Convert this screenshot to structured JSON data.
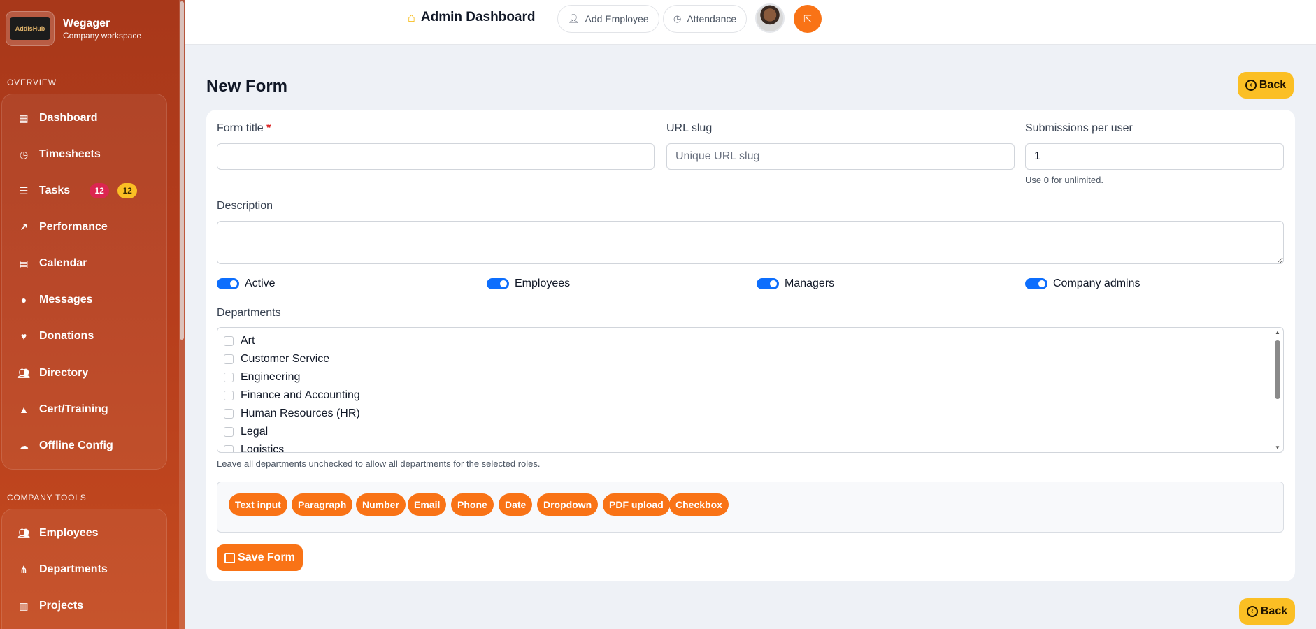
{
  "brand": {
    "logo_text": "AddisHub",
    "name": "Wegager",
    "subtitle": "Company workspace"
  },
  "sidebar": {
    "overview_label": "OVERVIEW",
    "items": [
      {
        "label": "Dashboard",
        "icon": "dashboard-icon"
      },
      {
        "label": "Timesheets",
        "icon": "clock-icon"
      },
      {
        "label": "Tasks",
        "icon": "list-icon",
        "badge_red": "12",
        "badge_yellow": "12"
      },
      {
        "label": "Performance",
        "icon": "chart-line-icon"
      },
      {
        "label": "Calendar",
        "icon": "calendar-icon"
      },
      {
        "label": "Messages",
        "icon": "chat-icon"
      },
      {
        "label": "Donations",
        "icon": "heart-icon"
      },
      {
        "label": "Directory",
        "icon": "people-icon"
      },
      {
        "label": "Cert/Training",
        "icon": "graduation-cap-icon"
      },
      {
        "label": "Offline Config",
        "icon": "cloud-upload-icon"
      }
    ],
    "tools_label": "COMPANY TOOLS",
    "tools": [
      {
        "label": "Employees",
        "icon": "people-icon"
      },
      {
        "label": "Departments",
        "icon": "sitemap-icon"
      },
      {
        "label": "Projects",
        "icon": "kanban-icon"
      }
    ]
  },
  "topbar": {
    "title": "Admin Dashboard",
    "add_employee": "Add Employee",
    "attendance": "Attendance"
  },
  "page": {
    "title": "New Form",
    "back_label": "Back"
  },
  "form": {
    "title_label": "Form title",
    "required_mark": "*",
    "title_value": "",
    "slug_label": "URL slug",
    "slug_placeholder": "Unique URL slug",
    "submissions_label": "Submissions per user",
    "submissions_value": "1",
    "submissions_hint": "Use 0 for unlimited.",
    "description_label": "Description",
    "toggles": [
      {
        "label": "Active",
        "on": true
      },
      {
        "label": "Employees",
        "on": true
      },
      {
        "label": "Managers",
        "on": true
      },
      {
        "label": "Company admins",
        "on": true
      }
    ],
    "departments_label": "Departments",
    "departments": [
      "Art",
      "Customer Service",
      "Engineering",
      "Finance and Accounting",
      "Human Resources (HR)",
      "Legal",
      "Logistics"
    ],
    "departments_hint": "Leave all departments unchecked to allow all departments for the selected roles.",
    "field_types": [
      "Text input",
      "Paragraph",
      "Number",
      "Email",
      "Phone",
      "Date",
      "Dropdown",
      "PDF upload",
      "Checkbox"
    ],
    "save_label": "Save Form"
  },
  "colors": {
    "accent": "#f97316",
    "back": "#fbbf24",
    "toggle": "#0d6efd",
    "sidebar": "#b53d1c"
  }
}
